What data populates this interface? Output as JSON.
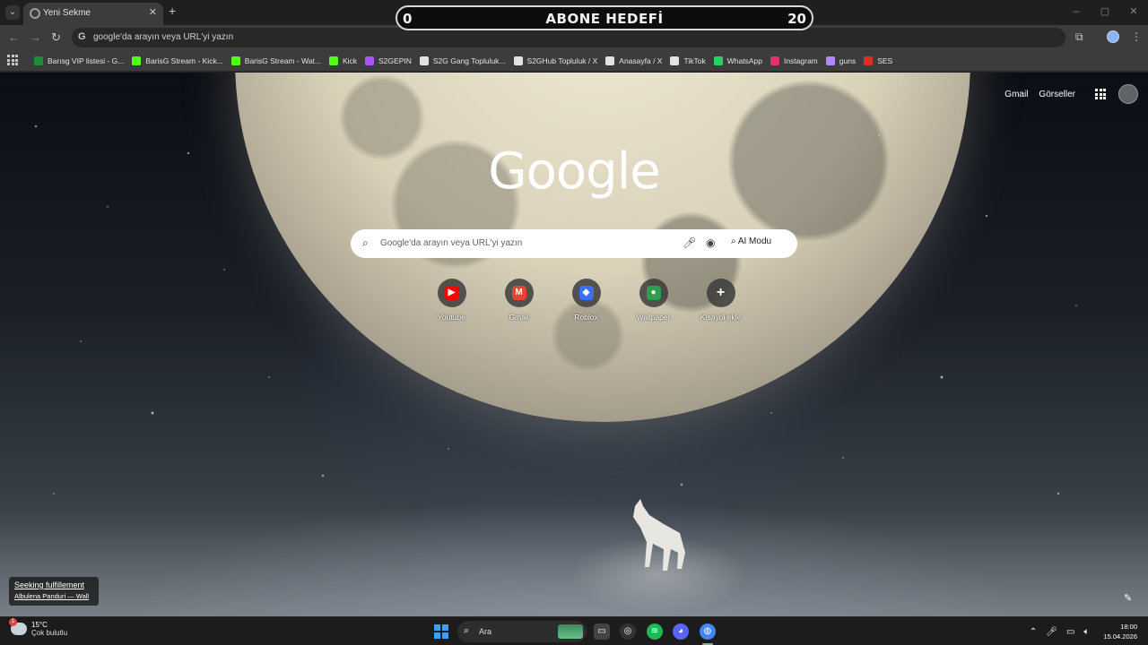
{
  "browser": {
    "tab": {
      "title": "Yeni Sekme"
    },
    "window_controls": [
      "–",
      "▢",
      "✕"
    ],
    "omnibox": {
      "text": "google'da arayın veya URL'yi yazın"
    }
  },
  "subscriber_goal": {
    "title": "ABONE HEDEFİ",
    "start": "0",
    "target": "20"
  },
  "bookmarks": [
    {
      "label": "Barısg VIP listesi - G...",
      "icon": "sheets-icon",
      "color": "#1e8e3e"
    },
    {
      "label": "BarisG Stream - Kick...",
      "icon": "kick-icon",
      "color": "#53fc18"
    },
    {
      "label": "BarisG Stream - Wat...",
      "icon": "kick-icon",
      "color": "#53fc18"
    },
    {
      "label": "Kick",
      "icon": "kick-icon",
      "color": "#53fc18"
    },
    {
      "label": "S2GEPIN",
      "icon": "s2g-icon",
      "color": "#a855f7"
    },
    {
      "label": "S2G Gang Topluluk...",
      "icon": "x-icon",
      "color": "#e3e3e3"
    },
    {
      "label": "S2GHub Topluluk / X",
      "icon": "x-icon",
      "color": "#e3e3e3"
    },
    {
      "label": "Anasayfa / X",
      "icon": "x-icon",
      "color": "#e3e3e3"
    },
    {
      "label": "TikTok",
      "icon": "tiktok-icon",
      "color": "#e3e3e3"
    },
    {
      "label": "WhatsApp",
      "icon": "whatsapp-icon",
      "color": "#25d366"
    },
    {
      "label": "Instagram",
      "icon": "instagram-icon",
      "color": "#e1306c"
    },
    {
      "label": "guns",
      "icon": "gun-icon",
      "color": "#b388ff"
    },
    {
      "label": "SES",
      "icon": "ses-icon",
      "color": "#d93025"
    }
  ],
  "newtab": {
    "top_links": {
      "gmail": "Gmail",
      "images": "Görseller"
    },
    "logo": "Google",
    "search": {
      "placeholder": "Google'da arayın veya URL'yi yazın",
      "ai_mode": "AI Modu"
    },
    "shortcuts": [
      {
        "label": "Youtube",
        "icon": "youtube-icon",
        "color": "#ff0000",
        "glyph": "▶"
      },
      {
        "label": "Gmail",
        "icon": "gmail-icon",
        "color": "#ea4335",
        "glyph": "M"
      },
      {
        "label": "Roblox",
        "icon": "roblox-icon",
        "color": "#3b6ff5",
        "glyph": "◆"
      },
      {
        "label": "Wallpaper",
        "icon": "wallpaper-icon",
        "color": "#2e9e4e",
        "glyph": "●"
      },
      {
        "label": "Kısayol ekle",
        "icon": "plus-icon",
        "color": "transparent",
        "glyph": "+"
      }
    ],
    "media_toast": {
      "title": "Seeking fulfillement",
      "subtitle": "Albulena Panduri — Wall"
    }
  },
  "taskbar": {
    "weather": {
      "temp": "15°C",
      "desc": "Çok bulutlu",
      "badge": "1"
    },
    "search_label": "Ara",
    "clock": {
      "time": "18:00",
      "date": "15.04.2026"
    }
  }
}
